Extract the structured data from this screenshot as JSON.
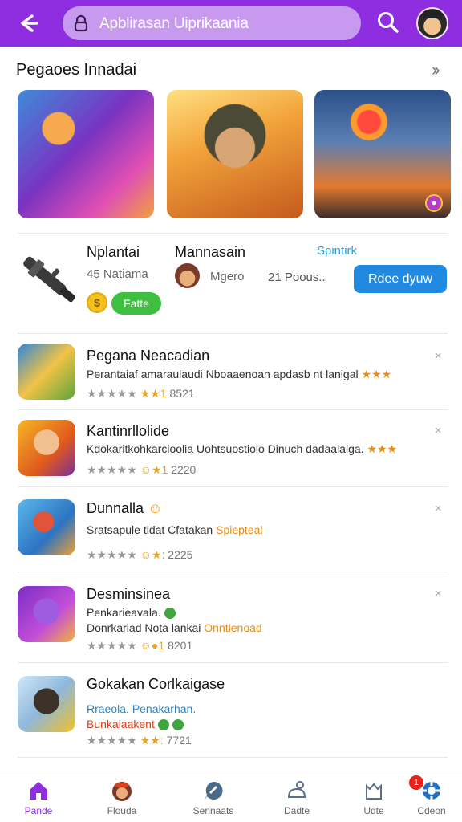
{
  "header": {
    "search_text": "Apblirasan Uiprikaania",
    "accent": "#8e2ee0"
  },
  "section": {
    "title": "Pegaoes Innadai",
    "more_icon": "chevron-right-icon"
  },
  "promo": {
    "name": "Nplantai",
    "sub": "45 Natiama",
    "coin_symbol": "$",
    "free_label": "Fatte",
    "developer": "Mannasain",
    "developer_sub": "Mgero",
    "link": "Spintirk",
    "points": "21 Poous..",
    "cta": "Rdee dyuw"
  },
  "items": [
    {
      "title": "Pegana Neacadian",
      "line1": "Perantaiaf amaraulaudi Nboaaenoan apdasb nt lanigal",
      "line1_stars": "★★★",
      "meta_stars": "★★★★★",
      "meta_gold": "★★1",
      "meta_num": "8521"
    },
    {
      "title": "Kantinrllolide",
      "line1": "Kdokaritkohkarcioolia Uohtsuostiolo Dinuch dadaalaiga.",
      "line1_stars": "★★★",
      "meta_stars": "★★★★★",
      "meta_gold": "☺★1",
      "meta_num": "2220"
    },
    {
      "title": "Dunnalla",
      "title_emoji": "☺",
      "line1": "Sratsapule tidat Cfatakan",
      "line1_colored": "Spiepteal",
      "meta_stars": "★★★★★",
      "meta_gold": "☺★:",
      "meta_num": "2225"
    },
    {
      "title": "Desminsinea",
      "line1": "Penkarieavala.",
      "line2": "Donrkariad Nota lankai",
      "line2_colored": "Onntlenoad",
      "meta_stars": "★★★★★",
      "meta_gold": "☺●1",
      "meta_num": "8201"
    },
    {
      "title": "Gokakan Corlkaigase",
      "line1": "Rraeola.",
      "line1_colored": "Penakarhan.",
      "line2_colored": "Bunkalaakent",
      "meta_stars": "★★★★★",
      "meta_gold": "★★:",
      "meta_num": "7721"
    }
  ],
  "close_label": "×",
  "nav": [
    {
      "label": "Pande",
      "icon": "home-icon"
    },
    {
      "label": "Flouda",
      "icon": "character-icon"
    },
    {
      "label": "Sennaats",
      "icon": "chat-icon"
    },
    {
      "label": "Dadte",
      "icon": "controller-icon"
    },
    {
      "label": "Udte",
      "icon": "bag-icon"
    },
    {
      "label": "Cdeon",
      "icon": "settings-icon"
    }
  ],
  "notif_count": "1"
}
